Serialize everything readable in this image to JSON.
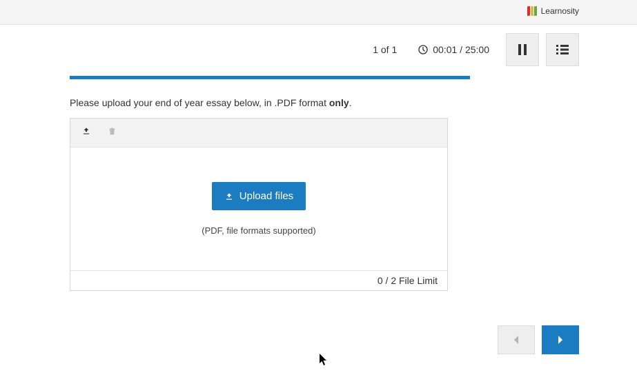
{
  "brand": {
    "name": "Learnosity"
  },
  "header": {
    "counter": "1 of 1",
    "timer": "00:01 / 25:00"
  },
  "question": {
    "prompt_prefix": "Please upload your end of year essay below, in .PDF format ",
    "prompt_bold": "only",
    "prompt_suffix": "."
  },
  "upload": {
    "button_label": "Upload files",
    "support_text": "(PDF, file formats supported)",
    "limit_text": "0 / 2 File Limit"
  }
}
